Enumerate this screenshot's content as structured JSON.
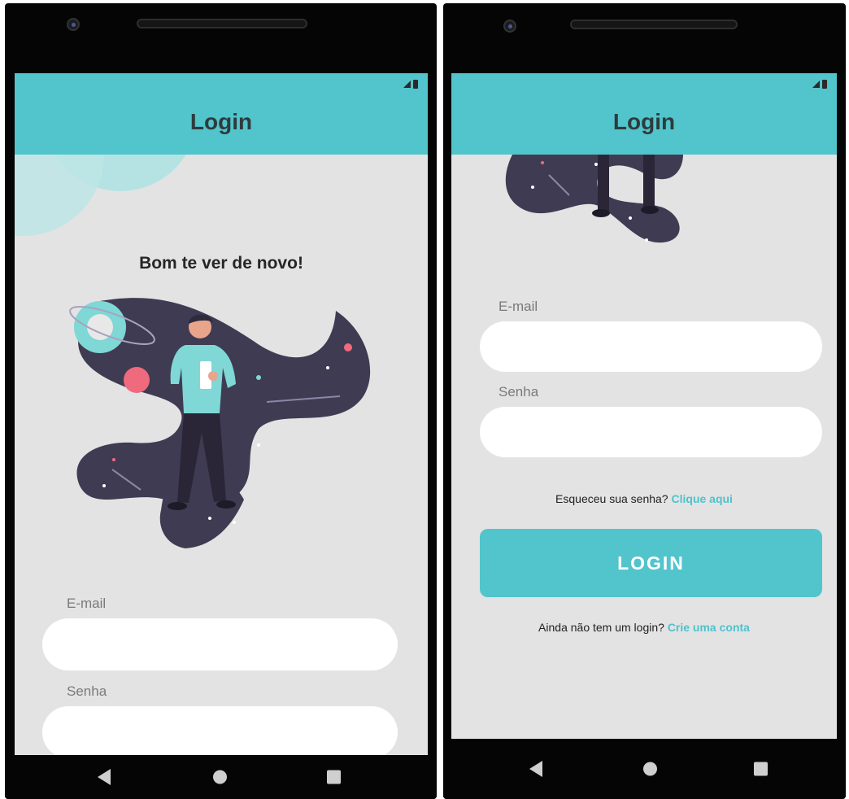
{
  "colors": {
    "accent": "#52c4cc",
    "link": "#4ec3cb",
    "background": "#e3e3e3",
    "input": "#ffffff",
    "illustration": "#3f3b52"
  },
  "status_icons": [
    "signal-icon",
    "battery-icon"
  ],
  "nav_icons": [
    "back-icon",
    "home-icon",
    "recents-icon"
  ],
  "screen1": {
    "appbar": {
      "title": "Login"
    },
    "greeting": "Bom te ver de novo!",
    "email": {
      "label": "E-mail",
      "value": ""
    },
    "password": {
      "label": "Senha",
      "value": ""
    }
  },
  "screen2": {
    "appbar": {
      "title": "Login"
    },
    "email": {
      "label": "E-mail",
      "value": ""
    },
    "password": {
      "label": "Senha",
      "value": ""
    },
    "forgot": {
      "text": "Esqueceu sua senha?",
      "link": "Clique aqui"
    },
    "login_button": "LOGIN",
    "signup": {
      "text": "Ainda não tem um login?",
      "link": "Crie uma conta"
    }
  }
}
